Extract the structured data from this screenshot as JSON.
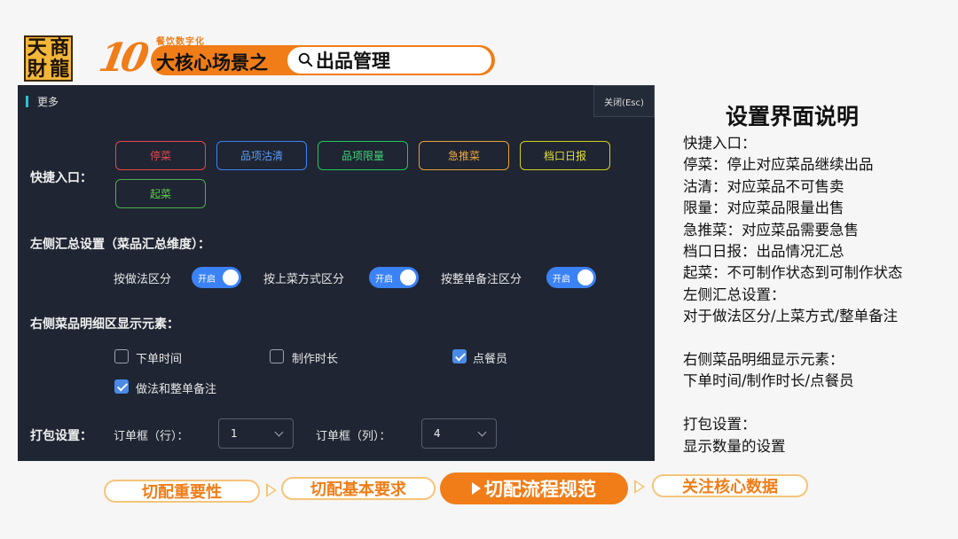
{
  "header": {
    "logo_chars": [
      "天",
      "商",
      "財",
      "龍"
    ],
    "ten": "10",
    "tag": "餐饮数字化",
    "title": "大核心场景之",
    "topic": "出品管理"
  },
  "panel": {
    "title": "更多",
    "close_label": "关闭(Esc)",
    "quick_entry": {
      "label": "快捷入口：",
      "buttons": [
        {
          "label": "停菜",
          "color": "#e5484d"
        },
        {
          "label": "品项沽清",
          "color": "#3b82f6"
        },
        {
          "label": "品项限量",
          "color": "#22c55e"
        },
        {
          "label": "急推菜",
          "color": "#e9a23b"
        },
        {
          "label": "档口日报",
          "color": "#d4d11c"
        },
        {
          "label": "起菜",
          "color": "#4caf50"
        }
      ]
    },
    "summary": {
      "label": "左侧汇总设置（菜品汇总维度）：",
      "options": [
        {
          "label": "按做法区分",
          "toggle": "开启"
        },
        {
          "label": "按上菜方式区分",
          "toggle": "开启"
        },
        {
          "label": "按整单备注区分",
          "toggle": "开启"
        }
      ]
    },
    "detail": {
      "label": "右侧菜品明细区显示元素：",
      "options": [
        {
          "label": "下单时间",
          "checked": false
        },
        {
          "label": "制作时长",
          "checked": false
        },
        {
          "label": "点餐员",
          "checked": true
        },
        {
          "label": "做法和整单备注",
          "checked": true
        }
      ]
    },
    "packing": {
      "label": "打包设置：",
      "row_label": "订单框（行）：",
      "row_value": "1",
      "col_label": "订单框（列）：",
      "col_value": "4"
    }
  },
  "explain": {
    "title": "设置界面说明",
    "lines": [
      "快捷入口：",
      "停菜：停止对应菜品继续出品",
      "沽清：对应菜品不可售卖",
      "限量：对应菜品限量出售",
      "急推菜：对应菜品需要急售",
      "档口日报：出品情况汇总",
      "起菜：不可制作状态到可制作状态",
      "左侧汇总设置：",
      "对于做法区分/上菜方式/整单备注",
      "",
      "右侧菜品明细显示元素：",
      "下单时间/制作时长/点餐员",
      "",
      "打包设置：",
      "显示数量的设置"
    ]
  },
  "steps": [
    {
      "label": "切配重要性",
      "active": false
    },
    {
      "label": "切配基本要求",
      "active": false
    },
    {
      "label": "切配流程规范",
      "active": true
    },
    {
      "label": "关注核心数据",
      "active": false
    }
  ]
}
